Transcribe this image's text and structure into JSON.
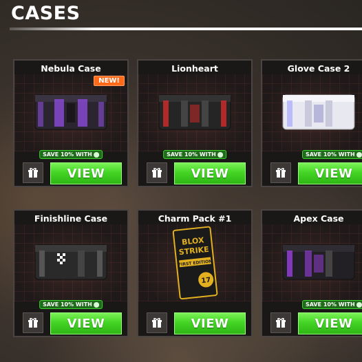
{
  "header": {
    "title": "CASES"
  },
  "cards": [
    {
      "name": "Nebula Case",
      "badge": "NEW!",
      "save": "SAVE 10% WITH",
      "view": "VIEW",
      "accent": "#8b4bd9",
      "body": "#2b2530"
    },
    {
      "name": "Lionheart",
      "save": "SAVE 10% WITH",
      "view": "VIEW",
      "accent": "#d62a2a",
      "body": "#252525"
    },
    {
      "name": "Glove Case 2",
      "save": "SAVE 10% WITH",
      "view": "VIEW",
      "accent": "#a8a8ff",
      "body": "#e8e8f0"
    },
    {
      "name": "Finishline Case",
      "save": "SAVE 10% WITH",
      "view": "VIEW",
      "accent": "#ffffff",
      "body": "#2a2a2a"
    },
    {
      "name": "Charm Pack #1",
      "view": "VIEW",
      "accent": "#e3b020",
      "body": "#1a1a1a",
      "art_text": {
        "line1": "BLOX",
        "line2": "STRIKE",
        "line3": "FIRST EDITION",
        "count": "17"
      }
    },
    {
      "name": "Apex Case",
      "save": "SAVE 10% WITH",
      "view": "VIEW",
      "accent": "#9b3fe0",
      "body": "#222024"
    }
  ]
}
